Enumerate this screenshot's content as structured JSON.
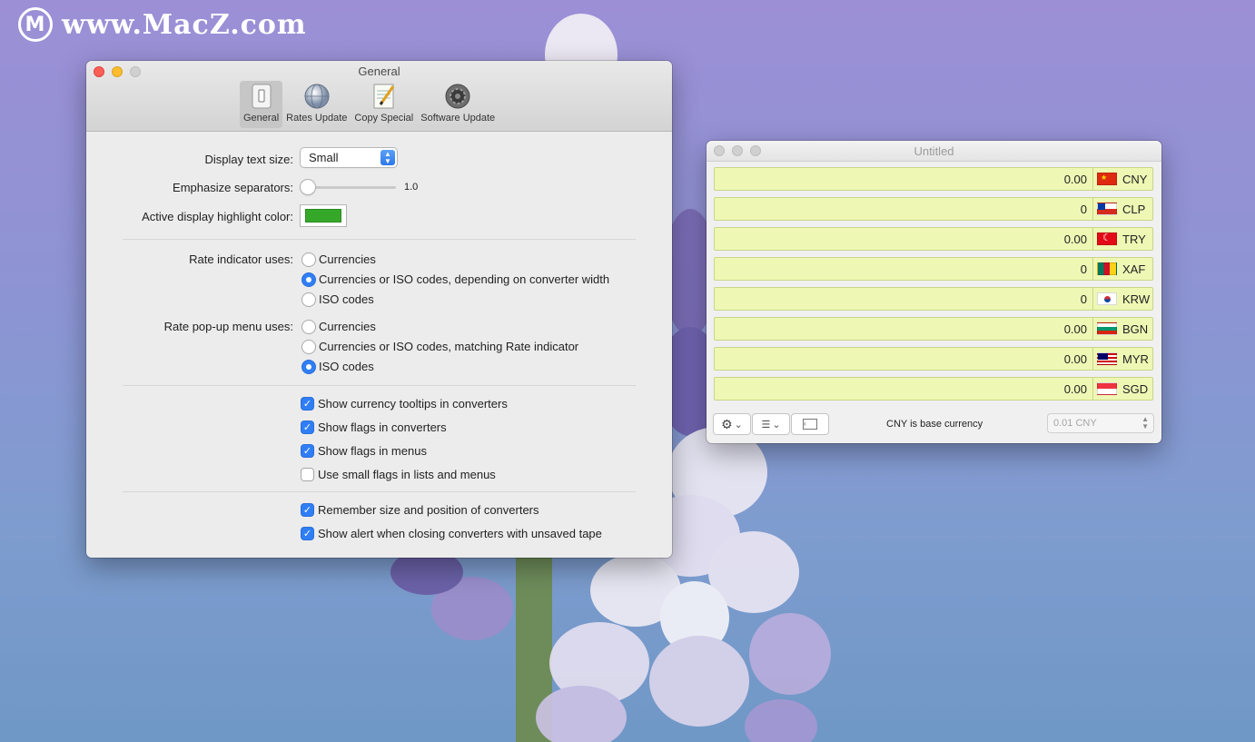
{
  "watermark": {
    "logo": "M",
    "text": "www.MacZ.com"
  },
  "general": {
    "title": "General",
    "toolbar": [
      {
        "label": "General",
        "icon": "switch-icon",
        "active": true
      },
      {
        "label": "Rates Update",
        "icon": "globe-icon"
      },
      {
        "label": "Copy Special",
        "icon": "notepad-icon"
      },
      {
        "label": "Software Update",
        "icon": "gear-icon"
      }
    ],
    "display_text_size": {
      "label": "Display text size:",
      "value": "Small"
    },
    "emphasize": {
      "label": "Emphasize separators:",
      "value": "1.0"
    },
    "highlight": {
      "label": "Active display highlight color:",
      "color": "#35a82a"
    },
    "rate_indicator": {
      "label": "Rate indicator uses:",
      "options": [
        "Currencies",
        "Currencies or ISO codes, depending on converter width",
        "ISO codes"
      ],
      "selected": 1
    },
    "rate_popup": {
      "label": "Rate pop-up menu uses:",
      "options": [
        "Currencies",
        "Currencies or ISO codes, matching Rate indicator",
        "ISO codes"
      ],
      "selected": 2
    },
    "checks_a": [
      {
        "label": "Show currency tooltips in converters",
        "checked": true
      },
      {
        "label": "Show flags in converters",
        "checked": true
      },
      {
        "label": "Show flags in menus",
        "checked": true
      },
      {
        "label": "Use small flags in lists and menus",
        "checked": false
      }
    ],
    "checks_b": [
      {
        "label": "Remember size and position of converters",
        "checked": true
      },
      {
        "label": "Show alert when closing converters with unsaved tape",
        "checked": true
      }
    ]
  },
  "converter": {
    "title": "Untitled",
    "rows": [
      {
        "value": "0.00",
        "code": "CNY"
      },
      {
        "value": "0",
        "code": "CLP"
      },
      {
        "value": "0.00",
        "code": "TRY"
      },
      {
        "value": "0",
        "code": "XAF"
      },
      {
        "value": "0",
        "code": "KRW"
      },
      {
        "value": "0.00",
        "code": "BGN"
      },
      {
        "value": "0.00",
        "code": "MYR"
      },
      {
        "value": "0.00",
        "code": "SGD"
      }
    ],
    "status": "CNY is base currency",
    "unit": "0.01 CNY",
    "field_color": "#eef8b4"
  }
}
